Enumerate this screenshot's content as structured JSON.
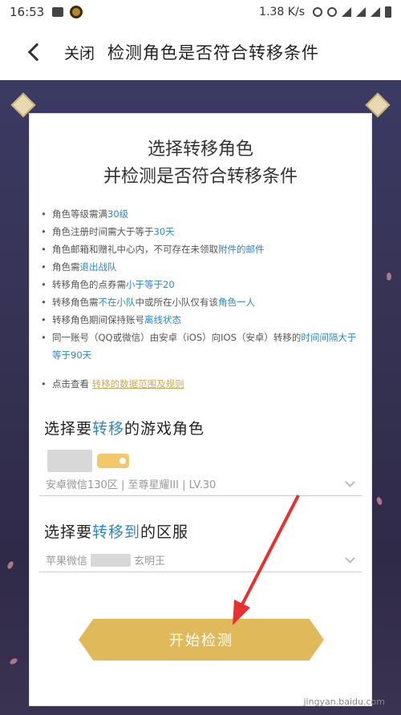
{
  "status_bar": {
    "time": "16:53",
    "network": "1.38 K/s"
  },
  "header": {
    "close_label": "关闭",
    "title": "检测角色是否符合转移条件"
  },
  "headline": {
    "line1": "选择转移角色",
    "line2": "并检测是否符合转移条件"
  },
  "rules": [
    {
      "parts": [
        {
          "t": "角色等级需满"
        },
        {
          "t": "30级",
          "hl": true
        }
      ]
    },
    {
      "parts": [
        {
          "t": "角色注册时间需大于等于"
        },
        {
          "t": "30天",
          "hl": true
        }
      ]
    },
    {
      "parts": [
        {
          "t": "角色邮箱和赠礼中心内，不可存在未领取"
        },
        {
          "t": "附件的邮件",
          "hl": true
        }
      ]
    },
    {
      "parts": [
        {
          "t": "角色需"
        },
        {
          "t": "退出战队",
          "hl": true
        }
      ]
    },
    {
      "parts": [
        {
          "t": "转移角色的点券需"
        },
        {
          "t": "小于等于20",
          "hl": true
        }
      ]
    },
    {
      "parts": [
        {
          "t": "转移角色需"
        },
        {
          "t": "不在小队",
          "hl": true
        },
        {
          "t": "中或所在小队仅有该"
        },
        {
          "t": "角色一人",
          "hl": true
        }
      ]
    },
    {
      "parts": [
        {
          "t": "转移角色期间保持账号"
        },
        {
          "t": "离线状态",
          "hl": true
        }
      ]
    },
    {
      "parts": [
        {
          "t": "同一账号（QQ或微信）由安卓（iOS）向IOS（安卓）转移的"
        },
        {
          "t": "时间间隔大于等于90天",
          "hl": true
        }
      ]
    }
  ],
  "check_link": {
    "prefix": "点击查看",
    "text": "转移的数据范围及规则"
  },
  "source_section": {
    "title_pre": "选择要",
    "title_hl": "转移",
    "title_post": "的游戏角色",
    "detail": "安卓微信130区 | 至尊星耀III | LV.30"
  },
  "target_section": {
    "title_pre": "选择要",
    "title_hl": "转移到",
    "title_post": "的区服",
    "server_prefix": "苹果微信",
    "server_suffix": "玄明王"
  },
  "start_button": {
    "label": "开始检测"
  },
  "watermark": {
    "line1": "jingyan.baidu.com"
  },
  "colors": {
    "accent": "#2f86c8",
    "button": "#e0b95a",
    "stage_bg": "#363253",
    "link": "#c8a85a"
  }
}
